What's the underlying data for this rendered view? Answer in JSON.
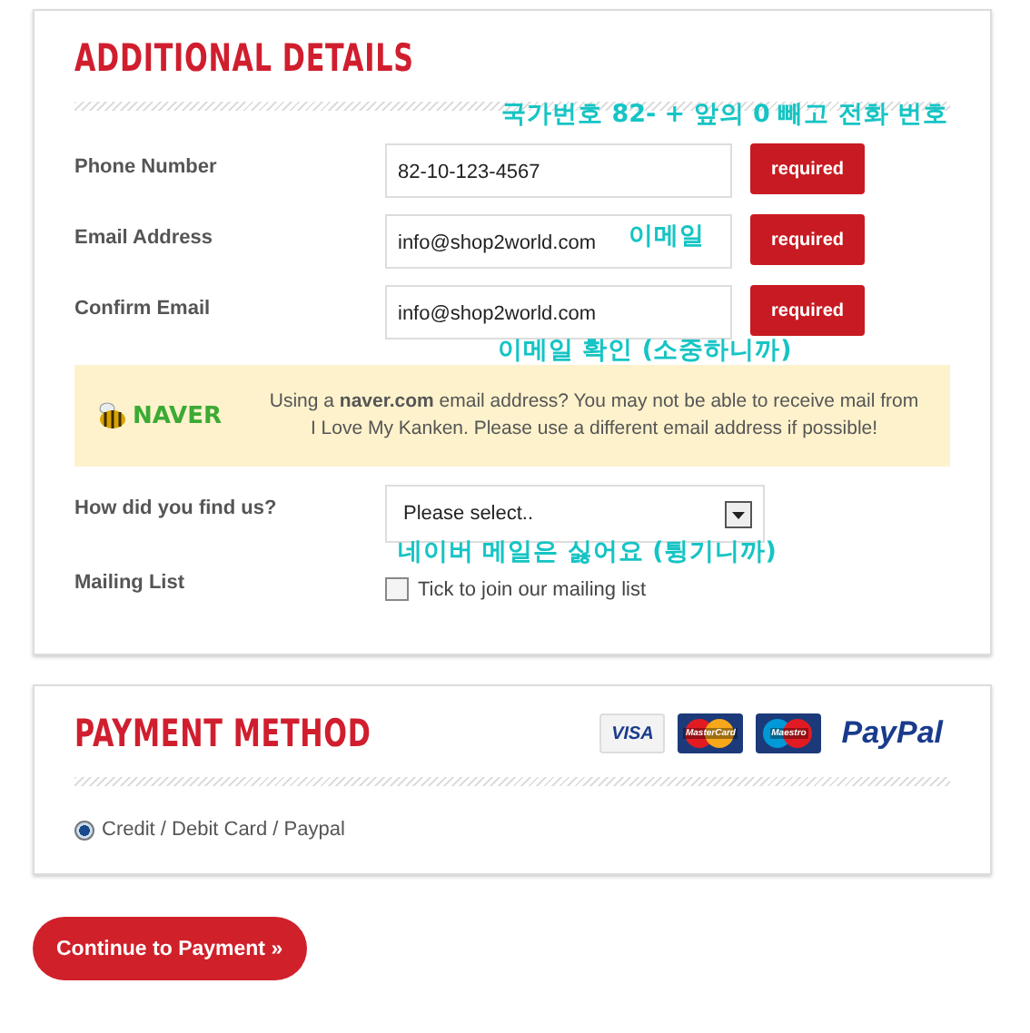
{
  "additional_details": {
    "title": "ADDITIONAL DETAILS",
    "fields": [
      {
        "label": "Phone Number",
        "value": "82-10-123-4567",
        "badge": "required"
      },
      {
        "label": "Email Address",
        "value": "info@shop2world.com",
        "badge": "required"
      },
      {
        "label": "Confirm Email",
        "value": "info@shop2world.com",
        "badge": "required"
      }
    ],
    "notice": {
      "logo": "NAVER",
      "text": "Using a **naver.com** email address? You may not be able to receive mail from I Love My Kanken. Please use a different email address if possible!"
    },
    "find_us": {
      "label": "How did you find us?",
      "value": "Please select.."
    },
    "mailing_list": {
      "label": "Mailing List",
      "checkbox_label": "Tick to join our mailing list",
      "checked": false
    },
    "annotations": [
      "국가번호 82- + 앞의 0 빼고 전화 번호",
      "이메일",
      "이메일 확인 (소중하니까)",
      "네이버 메일은 싫어요 (튕기니까)"
    ]
  },
  "payment_method": {
    "title": "PAYMENT METHOD",
    "logos": [
      {
        "kind": "visa",
        "text": "VISA"
      },
      {
        "kind": "mastercard",
        "text": "MasterCard"
      },
      {
        "kind": "maestro",
        "text": "Maestro"
      },
      {
        "kind": "paypal",
        "text": "PayPal"
      }
    ],
    "options": [
      {
        "label": "Credit / Debit Card / Paypal",
        "selected": true
      }
    ]
  },
  "continue_button": "Continue to Payment »"
}
